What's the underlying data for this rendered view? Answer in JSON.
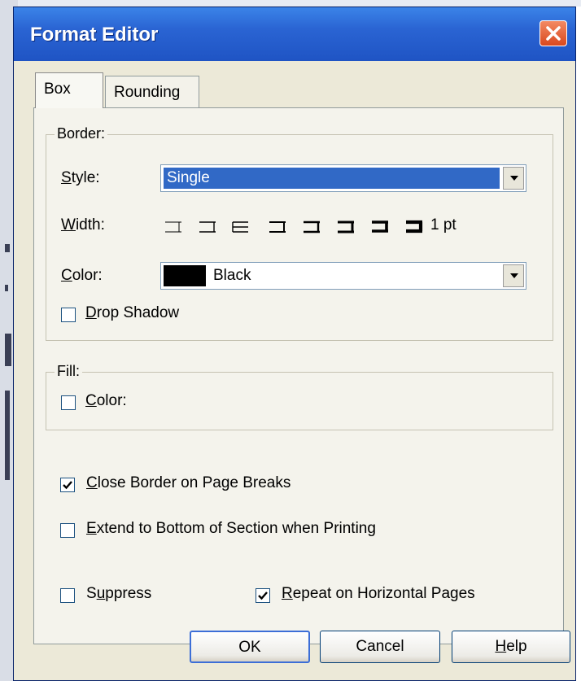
{
  "window": {
    "title": "Format Editor"
  },
  "tabs": [
    {
      "label": "Box",
      "active": true
    },
    {
      "label": "Rounding",
      "active": false
    }
  ],
  "border_group": {
    "legend": "Border:",
    "style_label": "Style:",
    "style_value": "Single",
    "width_label": "Width:",
    "width_value": "1 pt",
    "color_label": "Color:",
    "color_value": "Black",
    "drop_shadow_label": "Drop Shadow",
    "drop_shadow_checked": false
  },
  "fill_group": {
    "legend": "Fill:",
    "color_label": "Color:",
    "color_checked": false
  },
  "options": {
    "close_border_label": "Close Border on Page Breaks",
    "close_border_checked": true,
    "extend_label": "Extend to Bottom of Section when Printing",
    "extend_checked": false,
    "suppress_label": "Suppress",
    "suppress_checked": false,
    "repeat_label": "Repeat on Horizontal Pages",
    "repeat_checked": true
  },
  "buttons": {
    "ok": "OK",
    "cancel": "Cancel",
    "help": "Help"
  }
}
